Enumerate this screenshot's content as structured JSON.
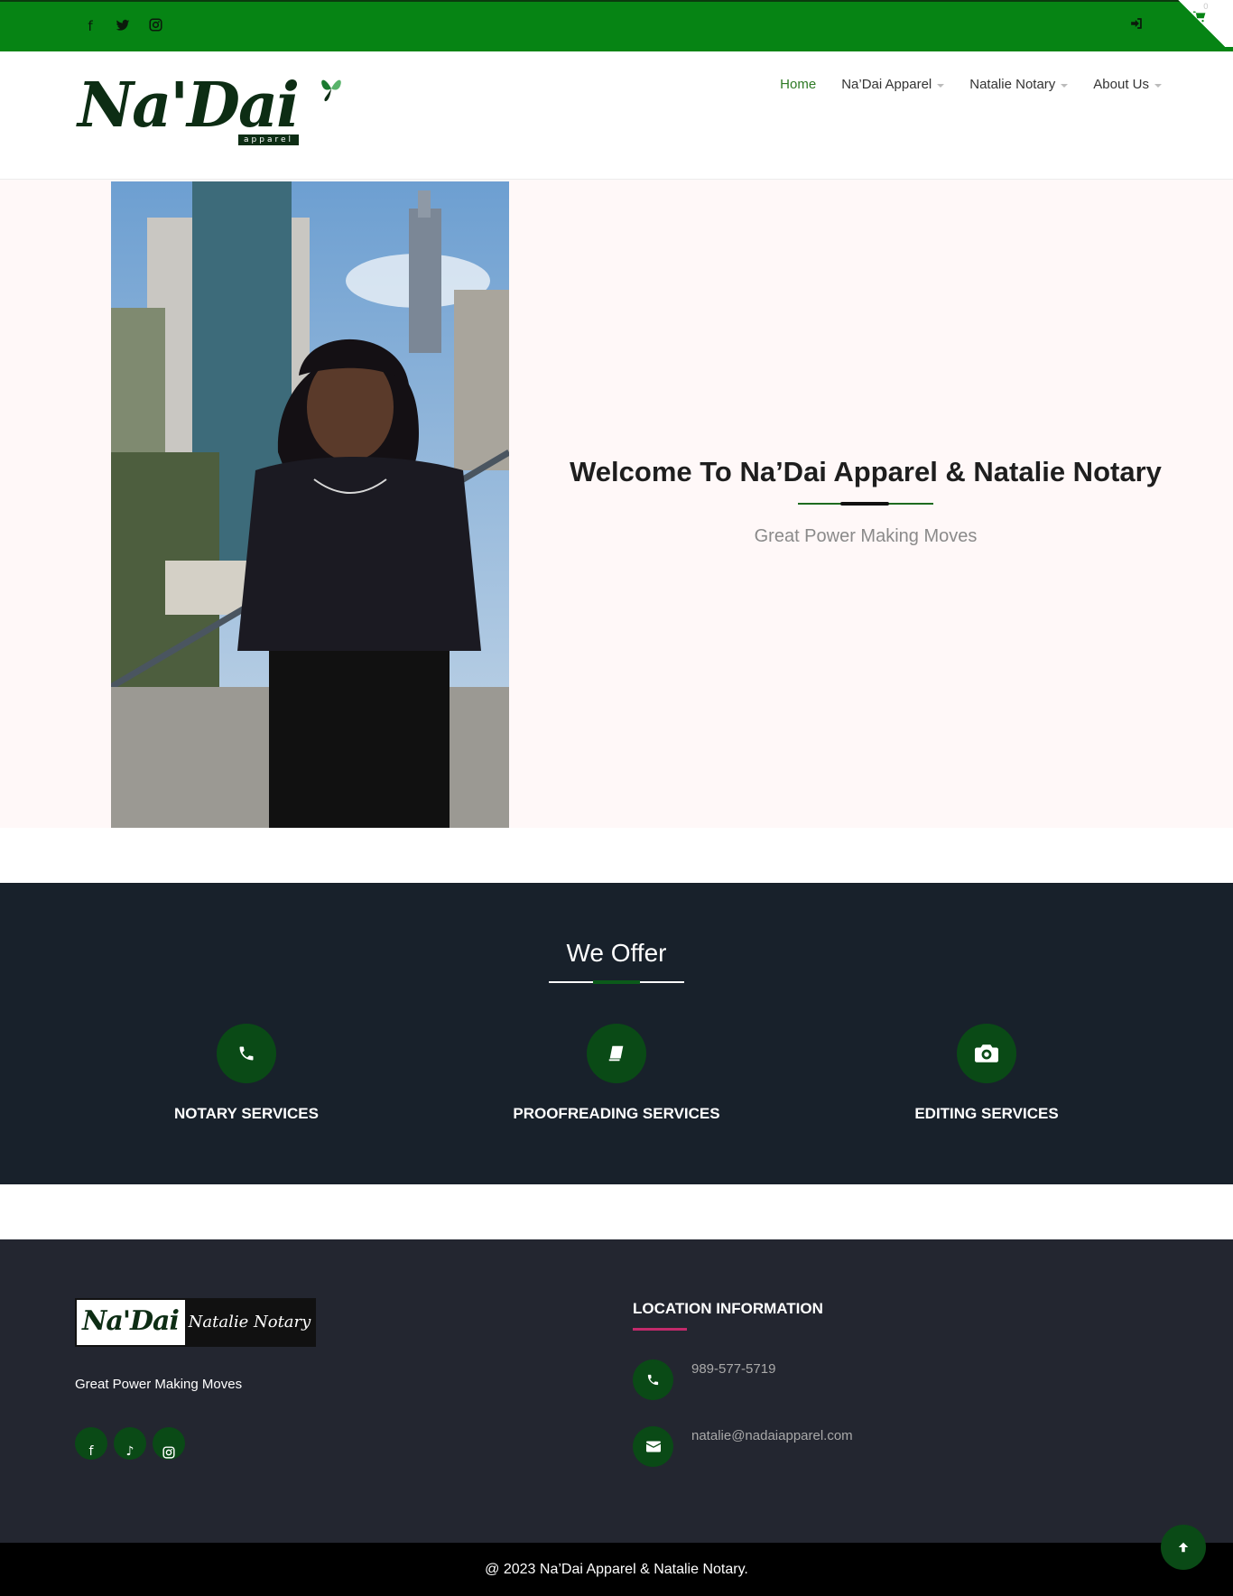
{
  "topbar": {
    "social_icons": [
      "facebook-icon",
      "twitter-icon",
      "instagram-icon"
    ],
    "cart_count": "0",
    "accent": "#068414"
  },
  "header": {
    "logo_text": "Na'Dai",
    "logo_sub": "apparel",
    "nav": [
      {
        "label": "Home",
        "active": true
      },
      {
        "label": "Na’Dai Apparel",
        "dropdown": true
      },
      {
        "label": "Natalie Notary",
        "dropdown": true
      },
      {
        "label": "About Us",
        "dropdown": true
      }
    ]
  },
  "hero": {
    "title": "Welcome To Na’Dai Apparel & Natalie Notary",
    "subtitle": "Great Power Making Moves"
  },
  "offer": {
    "title": "We Offer",
    "services": [
      {
        "label": "NOTARY SERVICES",
        "icon": "phone-icon"
      },
      {
        "label": "PROOFREADING SERVICES",
        "icon": "book-icon"
      },
      {
        "label": "EDITING SERVICES",
        "icon": "camera-icon"
      }
    ]
  },
  "footer": {
    "logo_left": "Na'Dai",
    "logo_right": "Natalie Notary",
    "tagline": "Great Power Making Moves",
    "social_icons": [
      "facebook-icon",
      "tiktok-icon",
      "instagram-icon"
    ],
    "location_title": "LOCATION INFORMATION",
    "phone": "989-577-5719",
    "email": "natalie@nadaiapparel.com",
    "copyright": "@ 2023 Na’Dai Apparel & Natalie Notary."
  }
}
